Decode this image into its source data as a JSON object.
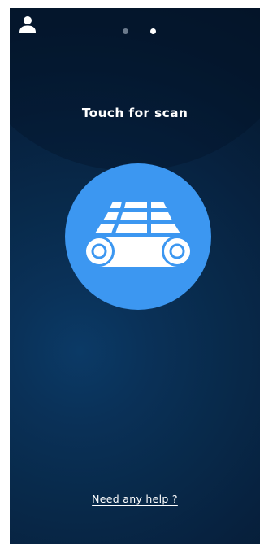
{
  "header": {
    "user_icon": "user-icon",
    "pager": {
      "count": 2,
      "active_index": 1
    }
  },
  "main": {
    "title": "Touch for scan",
    "scan_button_icon": "conveyor-grid-icon"
  },
  "footer": {
    "help_link": "Need any help ?"
  },
  "colors": {
    "accent": "#3c97f1",
    "background_dark": "#061b33",
    "text": "#ffffff",
    "dot_inactive": "#6b7a8c"
  }
}
